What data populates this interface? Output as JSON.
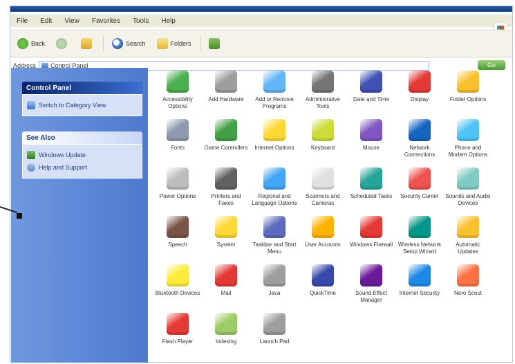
{
  "window": {
    "menu": [
      "File",
      "Edit",
      "View",
      "Favorites",
      "Tools",
      "Help"
    ]
  },
  "toolbar": {
    "back_label": "Back",
    "forward_label": "",
    "up_label": "",
    "search_label": "Search",
    "folders_label": "Folders",
    "views_label": ""
  },
  "address": {
    "label": "Address",
    "value": "Control Panel",
    "go_label": "Go"
  },
  "sidebar": {
    "control_panel_header": "Control Panel",
    "switch_view_label": "Switch to Category View",
    "see_also_header": "See Also",
    "see_also_items": [
      {
        "label": "Windows Update"
      },
      {
        "label": "Help and Support"
      }
    ]
  },
  "icons": [
    {
      "label": "Accessibility Options",
      "color": "#4caf50",
      "icon": "accessibility-icon"
    },
    {
      "label": "Add Hardware",
      "color": "#9e9e9e",
      "icon": "add-hardware-icon"
    },
    {
      "label": "Add or Remove Programs",
      "color": "#64b5f6",
      "icon": "add-remove-programs-icon"
    },
    {
      "label": "Administrative Tools",
      "color": "#757575",
      "icon": "administrative-tools-icon"
    },
    {
      "label": "Date and Time",
      "color": "#3f51b5",
      "icon": "date-time-icon"
    },
    {
      "label": "Display",
      "color": "#e53935",
      "icon": "display-icon"
    },
    {
      "label": "Folder Options",
      "color": "#fbc02d",
      "icon": "folder-options-icon"
    },
    {
      "label": "Fonts",
      "color": "#8d99ae",
      "icon": "fonts-icon"
    },
    {
      "label": "Game Controllers",
      "color": "#43a047",
      "icon": "game-controllers-icon"
    },
    {
      "label": "Internet Options",
      "color": "#fdd835",
      "icon": "internet-options-icon"
    },
    {
      "label": "Keyboard",
      "color": "#cddc39",
      "icon": "keyboard-icon"
    },
    {
      "label": "Mouse",
      "color": "#7e57c2",
      "icon": "mouse-icon"
    },
    {
      "label": "Network Connections",
      "color": "#1565c0",
      "icon": "network-connections-icon"
    },
    {
      "label": "Phone and Modem Options",
      "color": "#4fc3f7",
      "icon": "phone-modem-icon"
    },
    {
      "label": "Power Options",
      "color": "#bdbdbd",
      "icon": "power-options-icon"
    },
    {
      "label": "Printers and Faxes",
      "color": "#616161",
      "icon": "printers-faxes-icon"
    },
    {
      "label": "Regional and Language Options",
      "color": "#42a5f5",
      "icon": "regional-options-icon"
    },
    {
      "label": "Scanners and Cameras",
      "color": "#e0e0e0",
      "icon": "scanners-cameras-icon"
    },
    {
      "label": "Scheduled Tasks",
      "color": "#26a69a",
      "icon": "scheduled-tasks-icon"
    },
    {
      "label": "Security Center",
      "color": "#ef5350",
      "icon": "security-center-icon"
    },
    {
      "label": "Sounds and Audio Devices",
      "color": "#80cbc4",
      "icon": "sounds-audio-icon"
    },
    {
      "label": "Speech",
      "color": "#795548",
      "icon": "speech-icon"
    },
    {
      "label": "System",
      "color": "#fdd835",
      "icon": "system-icon"
    },
    {
      "label": "Taskbar and Start Menu",
      "color": "#5c6bc0",
      "icon": "taskbar-start-menu-icon"
    },
    {
      "label": "User Accounts",
      "color": "#ffb300",
      "icon": "user-accounts-icon"
    },
    {
      "label": "Windows Firewall",
      "color": "#e53935",
      "icon": "windows-firewall-icon"
    },
    {
      "label": "Wireless Network Setup Wizard",
      "color": "#009688",
      "icon": "wireless-setup-icon"
    },
    {
      "label": "Automatic Updates",
      "color": "#fbc02d",
      "icon": "automatic-updates-icon"
    },
    {
      "label": "Bluetooth Devices",
      "color": "#ffeb3b",
      "icon": "bluetooth-devices-icon"
    },
    {
      "label": "Mail",
      "color": "#e53935",
      "icon": "mail-icon"
    },
    {
      "label": "Java",
      "color": "#9e9e9e",
      "icon": "java-icon"
    },
    {
      "label": "QuickTime",
      "color": "#3949ab",
      "icon": "quicktime-icon"
    },
    {
      "label": "Sound Effect Manager",
      "color": "#6a1b9a",
      "icon": "sound-effect-icon"
    },
    {
      "label": "Internet Security",
      "color": "#1e88e5",
      "icon": "internet-security-icon"
    },
    {
      "label": "Nero Scout",
      "color": "#ff7043",
      "icon": "nero-scout-icon"
    },
    {
      "label": "Flash Player",
      "color": "#e53935",
      "icon": "flash-player-icon"
    },
    {
      "label": "Indexing",
      "color": "#9ccc65",
      "icon": "indexing-icon"
    },
    {
      "label": "Launch Pad",
      "color": "#9e9e9e",
      "icon": "launch-pad-icon"
    }
  ]
}
